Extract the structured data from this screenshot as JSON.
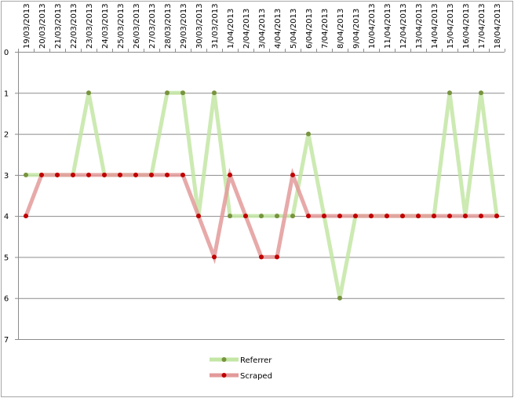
{
  "chart_data": {
    "type": "line",
    "title": "",
    "xlabel": "",
    "ylabel": "",
    "y_reversed": true,
    "ylim": [
      0,
      7
    ],
    "yticks": [
      "0",
      "1",
      "2",
      "3",
      "4",
      "5",
      "6",
      "7"
    ],
    "grid": "horizontal",
    "x_axis_position": "top",
    "legend_position": "bottom",
    "categories": [
      "19/03/2013",
      "20/03/2013",
      "21/03/2013",
      "22/03/2013",
      "23/03/2013",
      "24/03/2013",
      "25/03/2013",
      "26/03/2013",
      "27/03/2013",
      "28/03/2013",
      "29/03/2013",
      "30/03/2013",
      "31/03/2013",
      "1/04/2013",
      "2/04/2013",
      "3/04/2013",
      "4/04/2013",
      "5/04/2013",
      "6/04/2013",
      "7/04/2013",
      "8/04/2013",
      "9/04/2013",
      "10/04/2013",
      "11/04/2013",
      "12/04/2013",
      "13/04/2013",
      "14/04/2013",
      "15/04/2013",
      "16/04/2013",
      "17/04/2013",
      "18/04/2013"
    ],
    "series": [
      {
        "name": "Referrer",
        "line_color": "#c3e6a5",
        "marker_color": "#77933c",
        "values": [
          3,
          3,
          3,
          3,
          1,
          3,
          3,
          3,
          3,
          1,
          1,
          4,
          1,
          4,
          4,
          4,
          4,
          4,
          2,
          4,
          6,
          4,
          4,
          4,
          4,
          4,
          4,
          1,
          4,
          1,
          4
        ]
      },
      {
        "name": "Scraped",
        "line_color": "#e39a9a",
        "marker_color": "#c00000",
        "values": [
          4,
          3,
          3,
          3,
          3,
          3,
          3,
          3,
          3,
          3,
          3,
          4,
          5,
          3,
          4,
          5,
          5,
          3,
          4,
          4,
          4,
          4,
          4,
          4,
          4,
          4,
          4,
          4,
          4,
          4,
          4
        ]
      }
    ]
  }
}
